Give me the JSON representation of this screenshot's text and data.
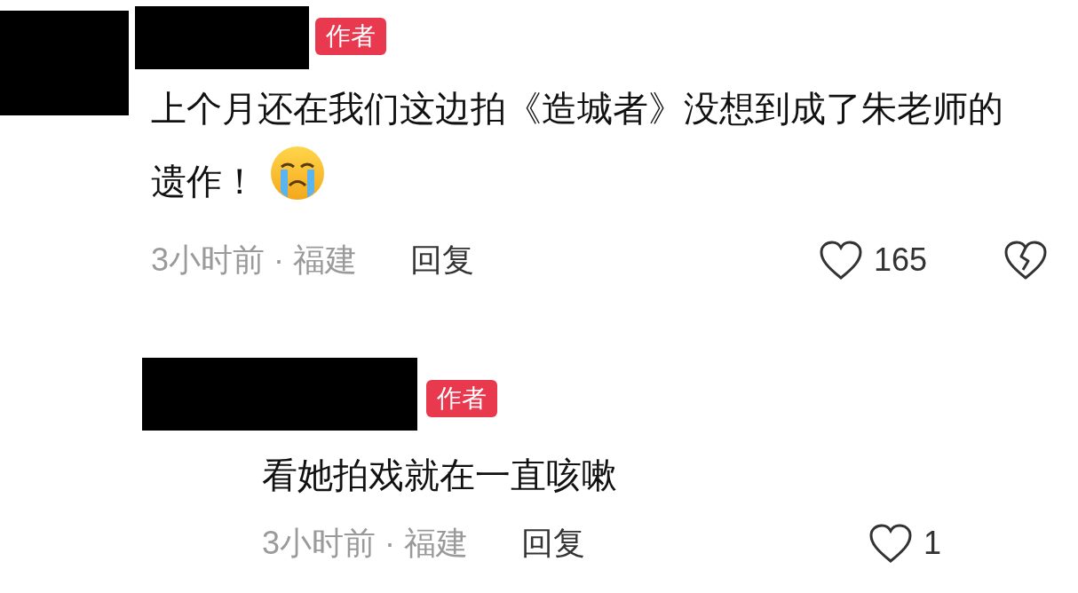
{
  "comments": [
    {
      "has_avatar": true,
      "badge": "作者",
      "text": "上个月还在我们这边拍《造城者》没想到成了朱老师的遗作！",
      "emoji": true,
      "time": "3小时前 · 福建",
      "reply": "回复",
      "likes": "165",
      "dislike_button": true
    },
    {
      "has_avatar": false,
      "badge": "作者",
      "text": "看她拍戏就在一直咳嗽",
      "emoji": false,
      "time": "3小时前 · 福建",
      "reply": "回复",
      "likes": "1",
      "dislike_button": false
    }
  ]
}
